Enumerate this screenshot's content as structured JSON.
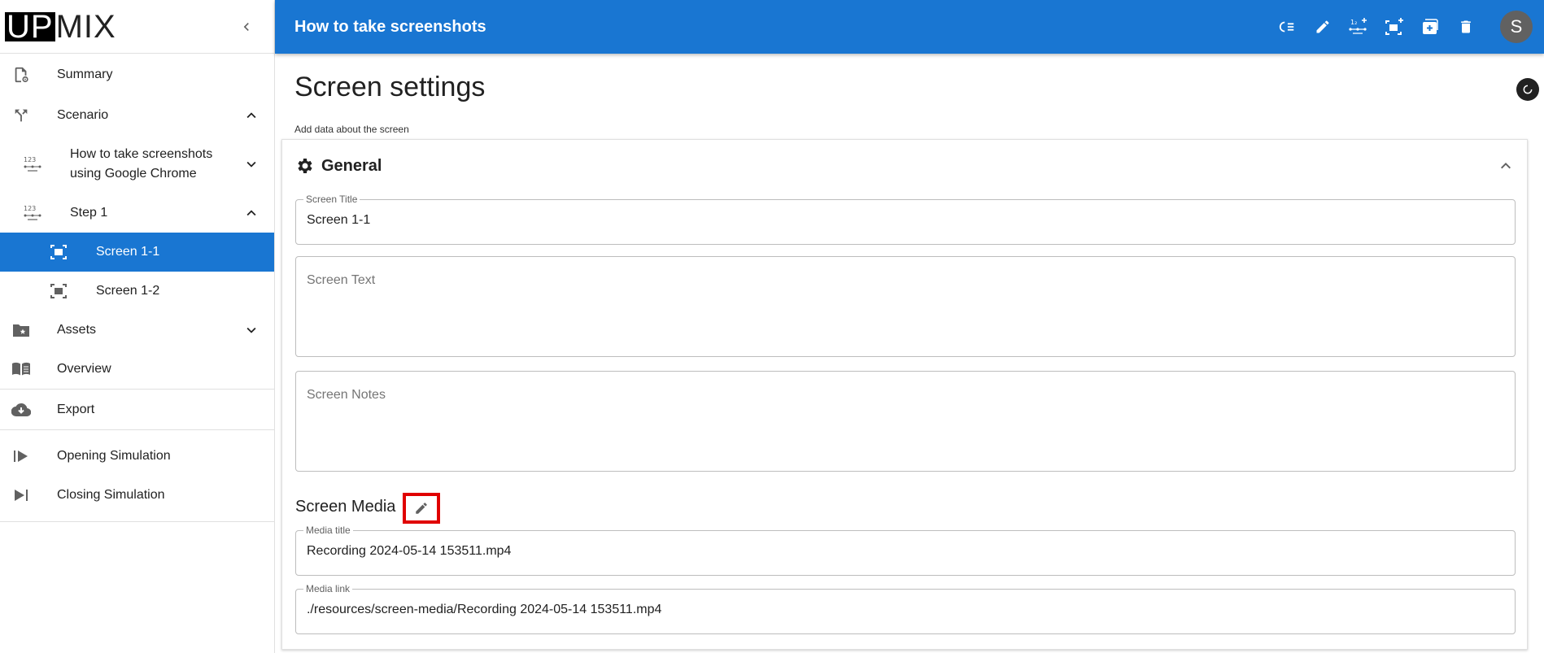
{
  "logo": {
    "part1": "UP",
    "part2": "MIX"
  },
  "sidebar": {
    "items": [
      {
        "label": "Summary",
        "icon": "summary-doc-gear-icon"
      },
      {
        "label": "Scenario",
        "icon": "scenario-split-icon",
        "expanded": true
      },
      {
        "label": "How to take screenshots using Google Chrome",
        "icon": "numbered-steps-icon",
        "expanded": false
      },
      {
        "label": "Step 1",
        "icon": "numbered-steps-icon",
        "expanded": true
      },
      {
        "label": "Screen 1-1",
        "icon": "screenshot-icon",
        "active": true
      },
      {
        "label": "Screen 1-2",
        "icon": "screenshot-icon"
      },
      {
        "label": "Assets",
        "icon": "folder-star-icon",
        "expanded": false
      },
      {
        "label": "Overview",
        "icon": "book-icon"
      },
      {
        "label": "Export",
        "icon": "cloud-download-icon"
      },
      {
        "label": "Opening Simulation",
        "icon": "play-start-icon"
      },
      {
        "label": "Closing Simulation",
        "icon": "skip-end-icon"
      }
    ]
  },
  "appbar": {
    "title": "How to take screenshots",
    "avatar_initial": "S",
    "color": "#1976d2"
  },
  "main": {
    "title": "Screen settings",
    "subtitle": "Add data about the screen",
    "general": {
      "title": "General",
      "screen_title_label": "Screen Title",
      "screen_title_value": "Screen 1-1",
      "screen_text_placeholder": "Screen Text",
      "screen_notes_placeholder": "Screen Notes"
    },
    "media": {
      "title": "Screen Media",
      "media_title_label": "Media title",
      "media_title_value": "Recording 2024-05-14 153511.mp4",
      "media_link_label": "Media link",
      "media_link_value": "./resources/screen-media/Recording 2024-05-14 153511.mp4"
    }
  },
  "colors": {
    "accent": "#1976d2",
    "highlight": "#e00000"
  }
}
